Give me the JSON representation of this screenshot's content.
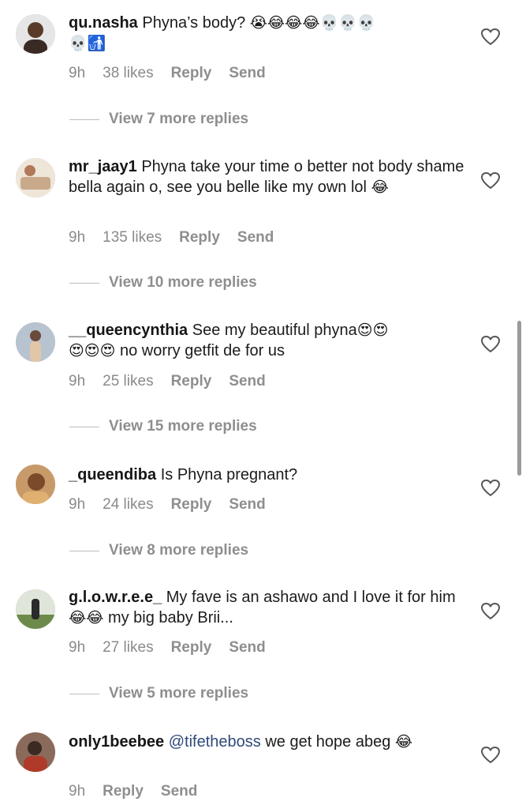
{
  "comments": [
    {
      "username": "qu.nasha",
      "text": "Phyna’s body?",
      "emojis_line1": "😭😂😂😂💀💀💀",
      "emojis_line2": "💀🚮",
      "time": "9h",
      "likes": "38 likes",
      "reply": "Reply",
      "send": "Send",
      "view_more": "View 7 more replies",
      "avatar_color": "#5a3b2a"
    },
    {
      "username": "mr_jaay1",
      "text": "Phyna take your time o better not body shame bella again o, see you belle like my own lol",
      "emojis": "😂",
      "time": "9h",
      "likes": "135 likes",
      "reply": "Reply",
      "send": "Send",
      "view_more": "View 10 more replies",
      "avatar_color": "#d9c9b4"
    },
    {
      "username": "__queencynthia",
      "text": "See my beautiful phyna",
      "emojis_line1": "😍😍",
      "emojis_line2": "😍😍😍",
      "text2": "no worry getfit de for us",
      "time": "9h",
      "likes": "25 likes",
      "reply": "Reply",
      "send": "Send",
      "view_more": "View 15 more replies",
      "avatar_color": "#8fa3b8"
    },
    {
      "username": "_queendiba",
      "text": "Is Phyna pregnant?",
      "time": "9h",
      "likes": "24 likes",
      "reply": "Reply",
      "send": "Send",
      "view_more": "View 8 more replies",
      "avatar_color": "#b88a5a"
    },
    {
      "username": "g.l.o.w.r.e.e_",
      "text": "My fave is an ashawo and I love it for him",
      "emojis": "😂😂",
      "text2": "my big baby Brii...",
      "time": "9h",
      "likes": "27 likes",
      "reply": "Reply",
      "send": "Send",
      "view_more": "View 5 more replies",
      "avatar_color": "#6c8a5a"
    },
    {
      "username": "only1beebee",
      "mention": "@tifetheboss",
      "text": "we get hope abeg",
      "emojis": "😂",
      "time": "9h",
      "reply": "Reply",
      "send": "Send",
      "avatar_color": "#7a4a3a"
    }
  ],
  "colors": {
    "text": "#1b1b1b",
    "meta": "#8e8e8e",
    "mention": "#2f4a7a",
    "background": "#ffffff"
  }
}
